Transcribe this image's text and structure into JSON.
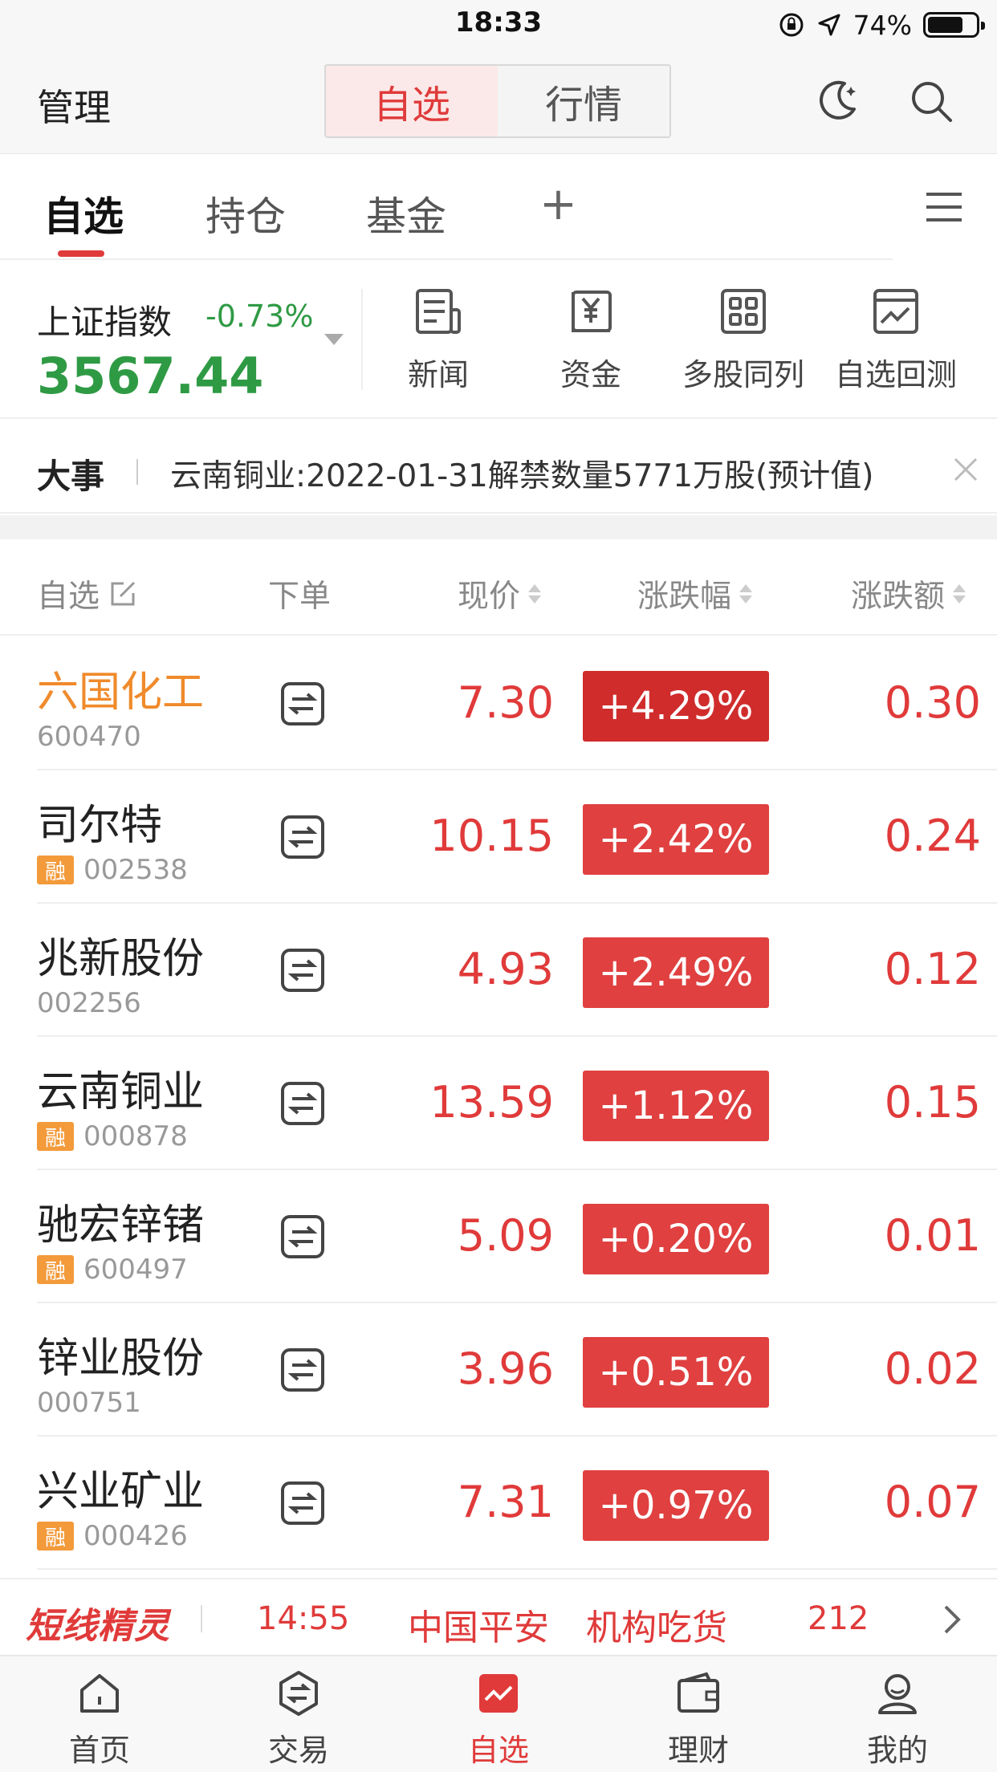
{
  "status": {
    "time": "18:33",
    "battery": "74%",
    "battery_level": 0.74
  },
  "header": {
    "manage": "管理",
    "seg_selected": "自选",
    "seg_market": "行情"
  },
  "tabs": [
    "自选",
    "持仓",
    "基金",
    "+"
  ],
  "index": {
    "name": "上证指数",
    "change": "-0.73%",
    "value": "3567.44"
  },
  "tools": [
    "新闻",
    "资金",
    "多股同列",
    "自选回测"
  ],
  "events": {
    "title": "大事",
    "text": "云南铜业:2022-01-31解禁数量5771万股(预计值)"
  },
  "table_header": {
    "name": "自选",
    "order": "下单",
    "price": "现价",
    "pct": "涨跌幅",
    "amount": "涨跌额"
  },
  "rows": [
    {
      "name": "六国化工",
      "code": "600470",
      "rong": "",
      "price": "7.30",
      "pct": "+4.29%",
      "amount": "0.30"
    },
    {
      "name": "司尔特",
      "code": "002538",
      "rong": "融",
      "price": "10.15",
      "pct": "+2.42%",
      "amount": "0.24"
    },
    {
      "name": "兆新股份",
      "code": "002256",
      "rong": "",
      "price": "4.93",
      "pct": "+2.49%",
      "amount": "0.12"
    },
    {
      "name": "云南铜业",
      "code": "000878",
      "rong": "融",
      "price": "13.59",
      "pct": "+1.12%",
      "amount": "0.15"
    },
    {
      "name": "驰宏锌锗",
      "code": "600497",
      "rong": "融",
      "price": "5.09",
      "pct": "+0.20%",
      "amount": "0.01"
    },
    {
      "name": "锌业股份",
      "code": "000751",
      "rong": "",
      "price": "3.96",
      "pct": "+0.51%",
      "amount": "0.02"
    },
    {
      "name": "兴业矿业",
      "code": "000426",
      "rong": "融",
      "price": "7.31",
      "pct": "+0.97%",
      "amount": "0.07"
    }
  ],
  "ticker": {
    "logo": "短线精灵",
    "time": "14:55",
    "stock": "中国平安",
    "action": "机构吃货",
    "number": "212"
  },
  "nav": [
    "首页",
    "交易",
    "自选",
    "理财",
    "我的"
  ],
  "colors": {
    "up": "#e03a3a",
    "down": "#2f9a44",
    "highlight": "#f08a2b"
  }
}
